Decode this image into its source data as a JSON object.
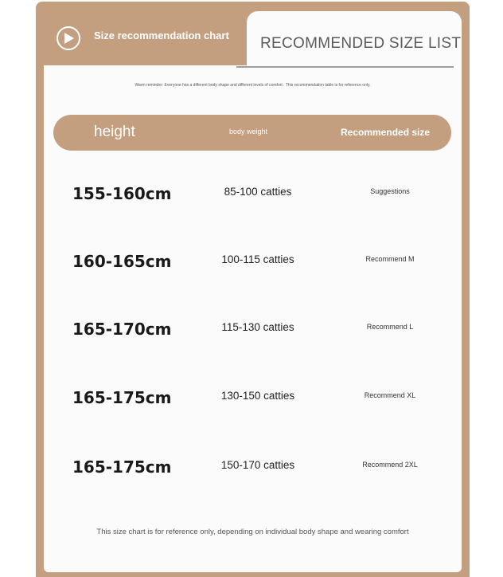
{
  "header": {
    "tab_title": "Size recommendation chart",
    "list_title": "RECOMMENDED SIZE LIST"
  },
  "reminder": "Warm reminder: Everyone has a different body shape and different levels of comfort . This recommendation table is for reference only.",
  "table": {
    "columns": [
      "height",
      "body weight",
      "Recommended size"
    ],
    "rows": [
      {
        "height": "155-160cm",
        "weight": "85-100 catties",
        "size": "Suggestions"
      },
      {
        "height": "160-165cm",
        "weight": "100-115 catties",
        "size": "Recommend M"
      },
      {
        "height": "165-170cm",
        "weight": "115-130 catties",
        "size": "Recommend L"
      },
      {
        "height": "165-175cm",
        "weight": "130-150 catties",
        "size": "Recommend XL"
      },
      {
        "height": "165-175cm",
        "weight": "150-170 catties",
        "size": "Recommend 2XL"
      }
    ]
  },
  "footer": "This size chart is for reference only, depending on individual body shape and wearing comfort",
  "colors": {
    "accent": "#c49f7f",
    "card": "#fbfbfb",
    "text": "#1a1a1a"
  },
  "icons": {
    "play": "play-icon"
  }
}
